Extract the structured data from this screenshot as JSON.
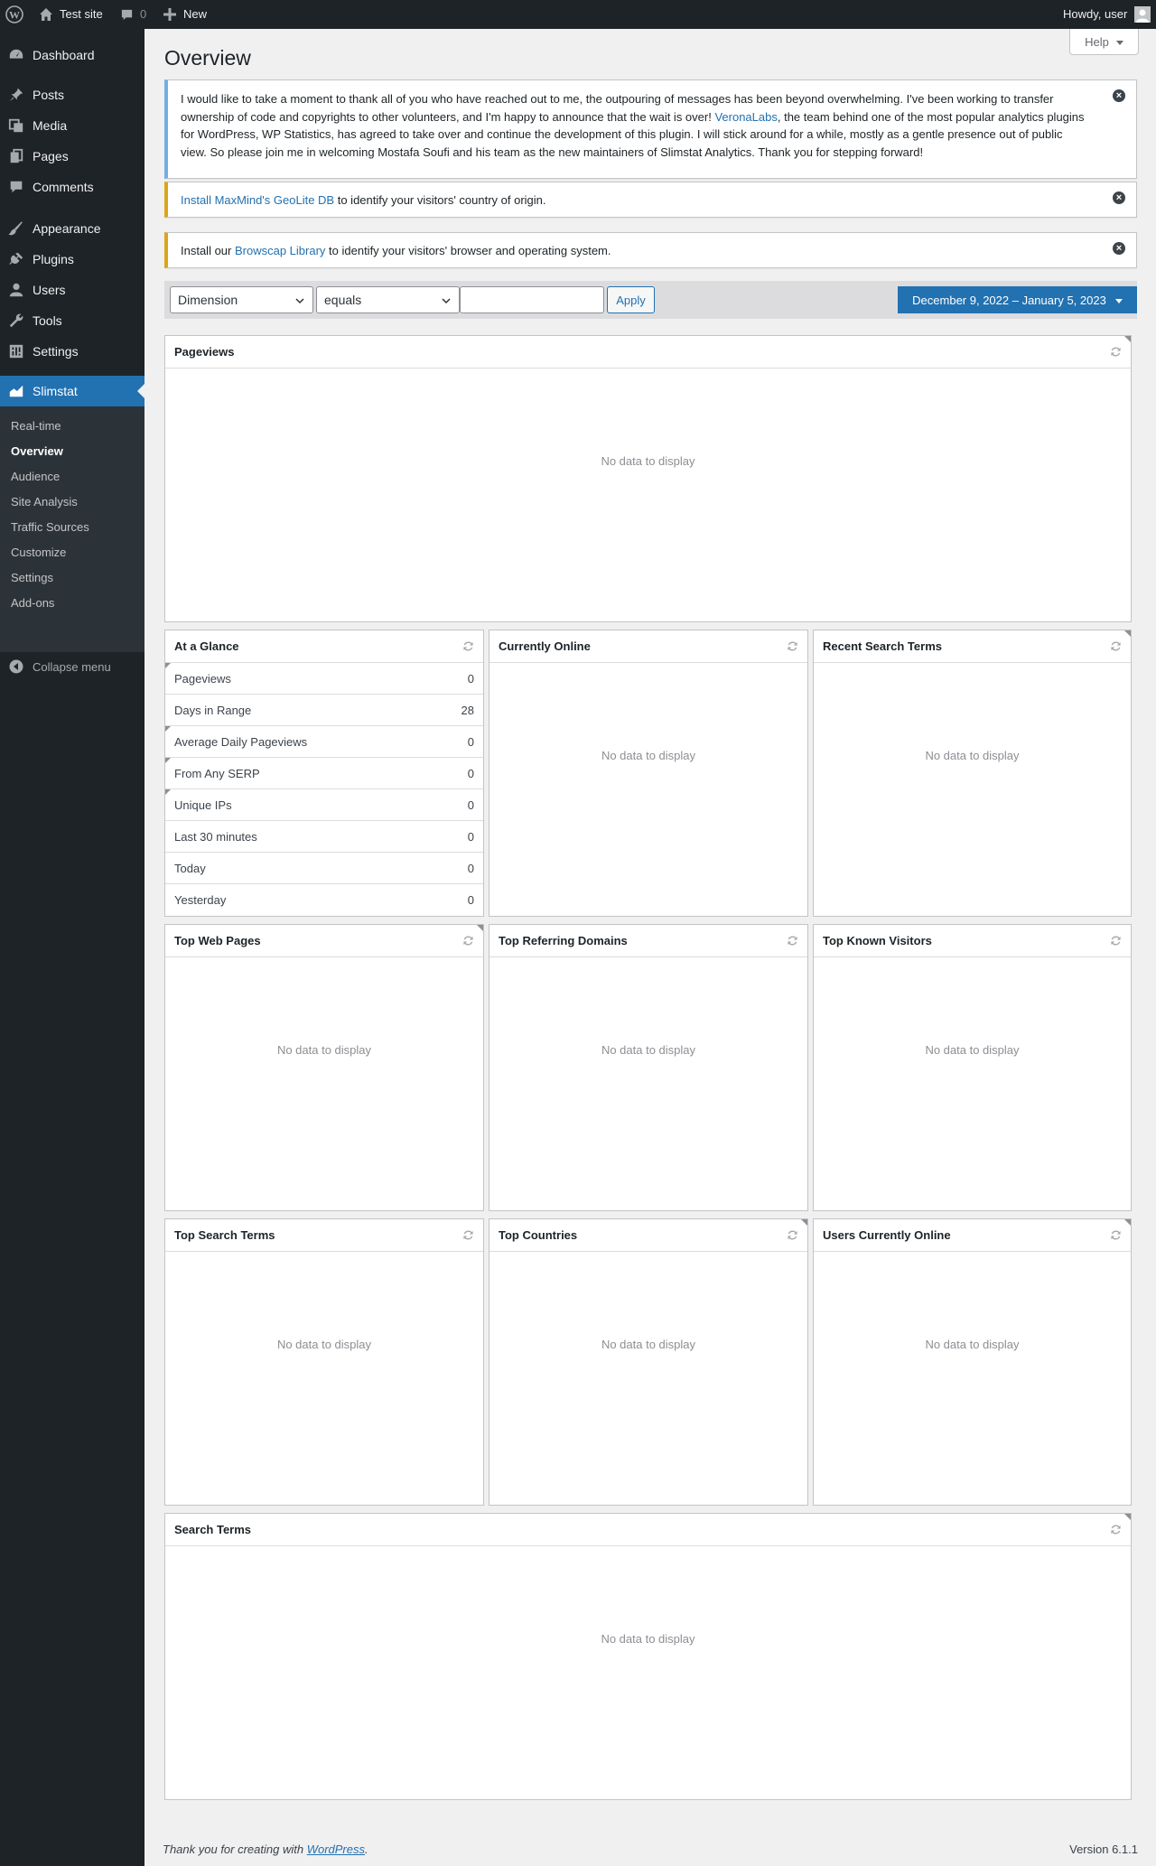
{
  "adminbar": {
    "site_name": "Test site",
    "comments_count": "0",
    "new_label": "New",
    "howdy": "Howdy, user"
  },
  "sidebar": {
    "items": [
      {
        "label": "Dashboard",
        "icon": "dashboard-icon"
      },
      {
        "label": "Posts",
        "icon": "pin-icon"
      },
      {
        "label": "Media",
        "icon": "media-icon"
      },
      {
        "label": "Pages",
        "icon": "pages-icon"
      },
      {
        "label": "Comments",
        "icon": "comment-icon"
      },
      {
        "label": "Appearance",
        "icon": "brush-icon"
      },
      {
        "label": "Plugins",
        "icon": "plugin-icon"
      },
      {
        "label": "Users",
        "icon": "users-icon"
      },
      {
        "label": "Tools",
        "icon": "wrench-icon"
      },
      {
        "label": "Settings",
        "icon": "settings-icon"
      },
      {
        "label": "Slimstat",
        "icon": "chart-area-icon"
      }
    ],
    "submenu": [
      "Real-time",
      "Overview",
      "Audience",
      "Site Analysis",
      "Traffic Sources",
      "Customize",
      "Settings",
      "Add-ons"
    ],
    "collapse_label": "Collapse menu"
  },
  "page": {
    "title": "Overview",
    "help_label": "Help"
  },
  "notices": {
    "announcement_part1": "I would like to take a moment to thank all of you who have reached out to me, the outpouring of messages has been beyond overwhelming. I've been working to transfer ownership of code and copyrights to other volunteers, and I'm happy to announce that the wait is over! ",
    "announcement_link": "VeronaLabs",
    "announcement_part2": ", the team behind one of the most popular analytics plugins for WordPress, WP Statistics, has agreed to take over and continue the development of this plugin. I will stick around for a while, mostly as a gentle presence out of public view. So please join me in welcoming Mostafa Soufi and his team as the new maintainers of Slimstat Analytics. Thank you for stepping forward!",
    "geolite_link": "Install MaxMind's GeoLite DB",
    "geolite_text": " to identify your visitors' country of origin.",
    "browscap_prefix": "Install our ",
    "browscap_link": "Browscap Library",
    "browscap_text": " to identify your visitors' browser and operating system."
  },
  "filters": {
    "dimension": "Dimension",
    "operator": "equals",
    "value": "",
    "apply_label": "Apply",
    "date_range": "December 9, 2022 – January 5, 2023"
  },
  "reports": {
    "no_data": "No data to display",
    "pageviews": "Pageviews",
    "at_a_glance": "At a Glance",
    "currently_online": "Currently Online",
    "recent_search_terms": "Recent Search Terms",
    "top_web_pages": "Top Web Pages",
    "top_referring_domains": "Top Referring Domains",
    "top_known_visitors": "Top Known Visitors",
    "top_search_terms": "Top Search Terms",
    "top_countries": "Top Countries",
    "users_currently_online": "Users Currently Online",
    "search_terms": "Search Terms"
  },
  "glance": [
    {
      "label": "Pageviews",
      "value": "0"
    },
    {
      "label": "Days in Range",
      "value": "28"
    },
    {
      "label": "Average Daily Pageviews",
      "value": "0"
    },
    {
      "label": "From Any SERP",
      "value": "0"
    },
    {
      "label": "Unique IPs",
      "value": "0"
    },
    {
      "label": "Last 30 minutes",
      "value": "0"
    },
    {
      "label": "Today",
      "value": "0"
    },
    {
      "label": "Yesterday",
      "value": "0"
    }
  ],
  "footer": {
    "thanks_prefix": "Thank you for creating with ",
    "thanks_link": "WordPress",
    "thanks_suffix": ".",
    "version": "Version 6.1.1"
  }
}
